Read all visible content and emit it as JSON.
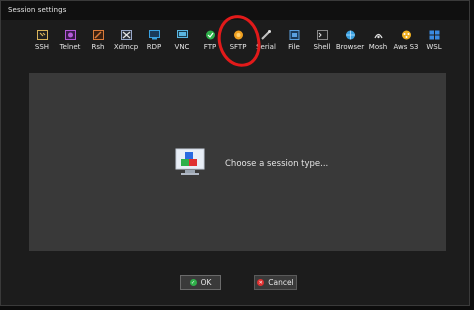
{
  "window": {
    "title": "Session settings"
  },
  "toolbar": {
    "items": [
      {
        "label": "SSH",
        "icon": "ssh-icon",
        "color": "#d9b45a"
      },
      {
        "label": "Telnet",
        "icon": "telnet-icon",
        "color": "#b45ad9"
      },
      {
        "label": "Rsh",
        "icon": "rsh-icon",
        "color": "#d97a3a"
      },
      {
        "label": "Xdmcp",
        "icon": "xdmcp-icon",
        "color": "#9aa9c9"
      },
      {
        "label": "RDP",
        "icon": "rdp-icon",
        "color": "#3aa0e0"
      },
      {
        "label": "VNC",
        "icon": "vnc-icon",
        "color": "#5ab5e0"
      },
      {
        "label": "FTP",
        "icon": "ftp-icon",
        "color": "#2fb04a"
      },
      {
        "label": "SFTP",
        "icon": "sftp-icon",
        "color": "#f0a020"
      },
      {
        "label": "Serial",
        "icon": "serial-icon",
        "color": "#c0c0c0"
      },
      {
        "label": "File",
        "icon": "file-icon",
        "color": "#5aa0e0"
      },
      {
        "label": "Shell",
        "icon": "shell-icon",
        "color": "#8a8a8a"
      },
      {
        "label": "Browser",
        "icon": "browser-icon",
        "color": "#3aa0e0"
      },
      {
        "label": "Mosh",
        "icon": "mosh-icon",
        "color": "#e0e0e0"
      },
      {
        "label": "Aws S3",
        "icon": "aws-s3-icon",
        "color": "#f0b020"
      },
      {
        "label": "WSL",
        "icon": "wsl-icon",
        "color": "#3a8ae0"
      }
    ]
  },
  "main": {
    "message": "Choose a session type..."
  },
  "buttons": {
    "ok_label": "OK",
    "cancel_label": "Cancel"
  },
  "colors": {
    "annotation": "#e21a1a",
    "ok": "#2fb04a",
    "cancel": "#e03030"
  }
}
